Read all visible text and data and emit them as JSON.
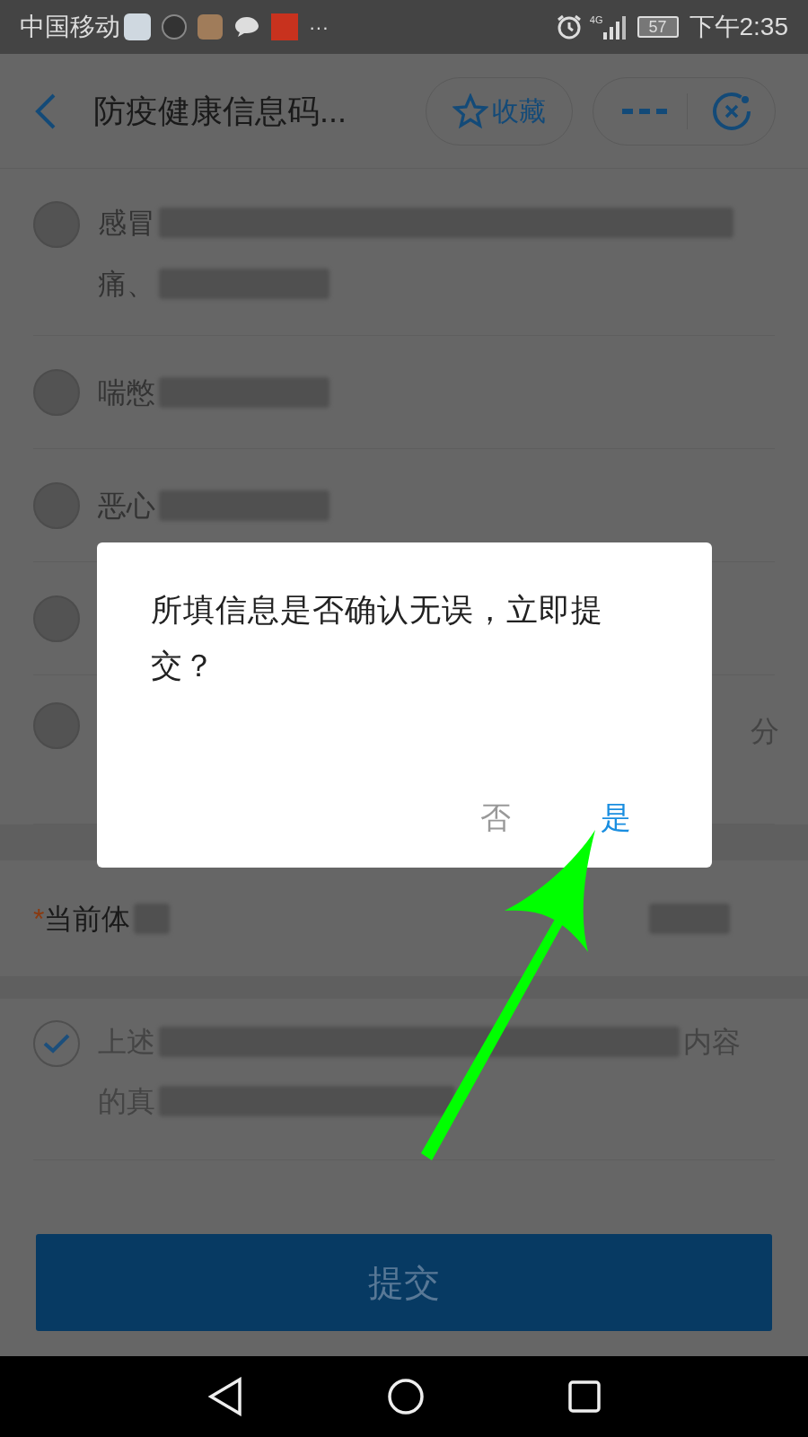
{
  "status_bar": {
    "carrier": "中国移动",
    "more": "···",
    "network": "4G",
    "battery": "57",
    "time": "下午2:35"
  },
  "nav_bar": {
    "title": "防疫健康信息码...",
    "favorite": "收藏"
  },
  "symptoms": [
    {
      "lines": [
        "感冒",
        "痛、"
      ],
      "checked": false
    },
    {
      "lines": [
        "喘憋"
      ],
      "checked": false
    },
    {
      "lines": [
        "恶心"
      ],
      "checked": false
    },
    {
      "checked": false
    },
    {
      "suffix": "分",
      "checked": false
    }
  ],
  "temperature": {
    "required_mark": "*",
    "label": "当前体"
  },
  "agreement": {
    "checked": true,
    "lines": [
      "上述",
      "的真"
    ],
    "line_end": "内容"
  },
  "submit_button": "提交",
  "dialog": {
    "message": "所填信息是否确认无误，立即提交？",
    "buttons": [
      {
        "label": "否",
        "kind": "cancel"
      },
      {
        "label": "是",
        "kind": "confirm"
      }
    ]
  }
}
